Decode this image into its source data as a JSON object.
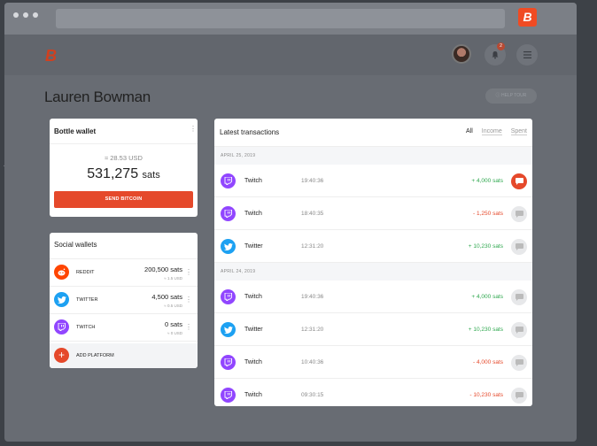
{
  "colors": {
    "accent": "#e5492b",
    "twitch": "#9146ff",
    "twitter": "#1da1f2",
    "reddit": "#ff4500",
    "positive": "#2fa84f",
    "negative": "#e5492b"
  },
  "browser": {
    "logo_glyph": "B"
  },
  "header": {
    "logo_glyph": "B",
    "notification_count": "2",
    "bell_icon": "bell-icon",
    "menu_icon": "menu-icon"
  },
  "page": {
    "title": "Lauren Bowman",
    "help_label": "HELP TOUR"
  },
  "wallet": {
    "title": "Bottle wallet",
    "usd": "≈ 28.53 USD",
    "sats_value": "531,275",
    "sats_unit": "sats",
    "send_label": "SEND BITCOIN"
  },
  "social": {
    "title": "Social wallets",
    "items": [
      {
        "name": "REDDIT",
        "sats": "200,500 sats",
        "usd": "≈ 1.5 USD",
        "icon": "reddit-icon"
      },
      {
        "name": "TWITTER",
        "sats": "4,500 sats",
        "usd": "≈ 0.5 USD",
        "icon": "twitter-icon"
      },
      {
        "name": "TWITCH",
        "sats": "0 sats",
        "usd": "≈ 0 USD",
        "icon": "twitch-icon"
      }
    ],
    "add_label": "ADD PLATFORM"
  },
  "transactions": {
    "title": "Latest transactions",
    "filters": [
      "All",
      "Income",
      "Spent"
    ],
    "groups": [
      {
        "date": "APRIL 25, 2019",
        "rows": [
          {
            "platform": "Twitch",
            "time": "19:40:36",
            "amount": "+ 4,000 sats",
            "direction": "in",
            "icon": "twitch-icon",
            "message_active": true
          },
          {
            "platform": "Twitch",
            "time": "18:40:35",
            "amount": "- 1,250 sats",
            "direction": "out",
            "icon": "twitch-icon",
            "message_active": false
          },
          {
            "platform": "Twitter",
            "time": "12:31:20",
            "amount": "+ 10,230 sats",
            "direction": "in",
            "icon": "twitter-icon",
            "message_active": false
          }
        ]
      },
      {
        "date": "APRIL 24, 2019",
        "rows": [
          {
            "platform": "Twitch",
            "time": "19:40:36",
            "amount": "+ 4,000 sats",
            "direction": "in",
            "icon": "twitch-icon",
            "message_active": false
          },
          {
            "platform": "Twitter",
            "time": "12:31:20",
            "amount": "+ 10,230 sats",
            "direction": "in",
            "icon": "twitter-icon",
            "message_active": false
          },
          {
            "platform": "Twitch",
            "time": "10:40:36",
            "amount": "- 4,000 sats",
            "direction": "out",
            "icon": "twitch-icon",
            "message_active": false
          },
          {
            "platform": "Twitch",
            "time": "09:30:15",
            "amount": "- 10,230 sats",
            "direction": "out",
            "icon": "twitch-icon",
            "message_active": false
          }
        ]
      }
    ]
  }
}
